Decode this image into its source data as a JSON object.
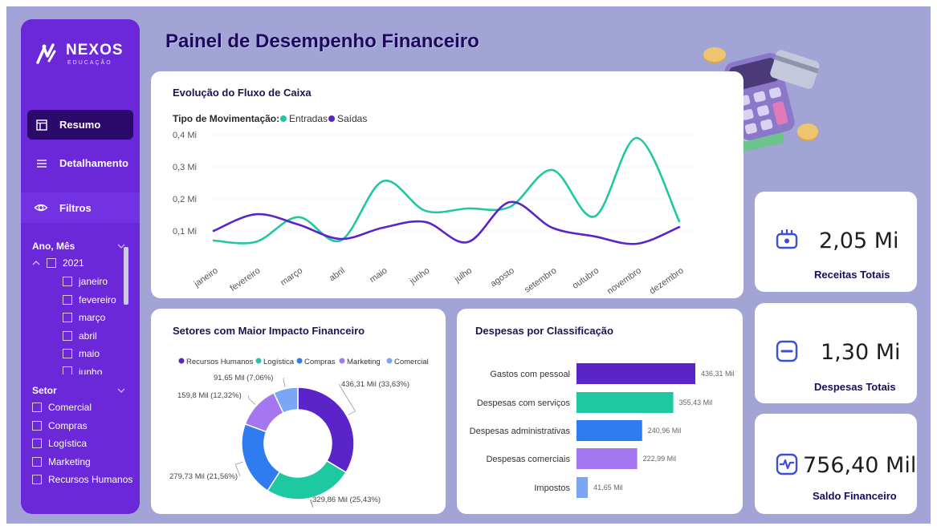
{
  "logo": {
    "name": "NEXOS",
    "sub": "EDUCAÇÃO"
  },
  "page_title": "Painel de Desempenho Financeiro",
  "nav": {
    "resumo": "Resumo",
    "detalhamento": "Detalhamento",
    "filtros": "Filtros"
  },
  "slicer_date": {
    "title": "Ano, Mês",
    "year": "2021",
    "months": [
      "janeiro",
      "fevereiro",
      "março",
      "abril",
      "maio",
      "junho"
    ]
  },
  "slicer_sector": {
    "title": "Setor",
    "items": [
      "Comercial",
      "Compras",
      "Logística",
      "Marketing",
      "Recursos Humanos"
    ]
  },
  "line_card": {
    "title": "Evolução do Fluxo de Caixa",
    "legend_prefix": "Tipo de Movimentação:"
  },
  "donut_card": {
    "title": "Setores com Maior Impacto Financeiro"
  },
  "bar_card": {
    "title": "Despesas por Classificação"
  },
  "kpis": {
    "receitas": {
      "value": "2,05 Mi",
      "label": "Receitas Totais",
      "icon": "wallet-icon"
    },
    "despesas": {
      "value": "1,30 Mi",
      "label": "Despesas Totais",
      "icon": "minus-icon"
    },
    "saldo": {
      "value": "756,40 Mil",
      "label": "Saldo Financeiro",
      "icon": "pulse-icon"
    }
  },
  "colors": {
    "teal": "#1ec8a0",
    "purple": "#5a24c9",
    "blue": "#2f7bf0",
    "lilac": "#a477f0",
    "light_blue": "#7aa6f5",
    "sidebar": "#6a28d9",
    "background": "#a3a4d6"
  },
  "chart_data": [
    {
      "type": "line",
      "title": "Evolução do Fluxo de Caixa",
      "x": [
        "janeiro",
        "fevereiro",
        "março",
        "abril",
        "maio",
        "junho",
        "julho",
        "agosto",
        "setembro",
        "outubro",
        "novembro",
        "dezembro"
      ],
      "y_ticks": [
        "0,1 Mi",
        "0,2 Mi",
        "0,3 Mi",
        "0,4 Mi"
      ],
      "ylim": [
        0,
        0.4
      ],
      "series": [
        {
          "name": "Entradas",
          "color": "#1ec8a0",
          "values": [
            0.07,
            0.066,
            0.143,
            0.07,
            0.255,
            0.163,
            0.17,
            0.175,
            0.29,
            0.145,
            0.39,
            0.13
          ]
        },
        {
          "name": "Saídas",
          "color": "#5a24c9",
          "values": [
            0.1,
            0.152,
            0.12,
            0.075,
            0.11,
            0.128,
            0.065,
            0.19,
            0.11,
            0.083,
            0.06,
            0.112
          ]
        }
      ],
      "grid": true,
      "legend": "top-left"
    },
    {
      "type": "pie",
      "title": "Setores com Maior Impacto Financeiro",
      "slices": [
        {
          "name": "Recursos Humanos",
          "value": 436.31,
          "label": "436,31 Mil (33,63%)",
          "color": "#5a24c9"
        },
        {
          "name": "Logística",
          "value": 329.86,
          "label": "329,86 Mil (25,43%)",
          "color": "#1ec8a0"
        },
        {
          "name": "Compras",
          "value": 279.73,
          "label": "279,73 Mil (21,56%)",
          "color": "#2f7bf0"
        },
        {
          "name": "Marketing",
          "value": 159.8,
          "label": "159,8 Mil (12,32%)",
          "color": "#a477f0"
        },
        {
          "name": "Comercial",
          "value": 91.65,
          "label": "91,65 Mil (7,06%)",
          "color": "#7aa6f5"
        }
      ],
      "legend": "top"
    },
    {
      "type": "bar",
      "title": "Despesas por Classificação",
      "categories": [
        "Gastos com pessoal",
        "Despesas com serviços",
        "Despesas administrativas",
        "Despesas comerciais",
        "Impostos"
      ],
      "values": [
        436.31,
        355.43,
        240.96,
        222.99,
        41.65
      ],
      "labels": [
        "436,31 Mil",
        "355,43 Mil",
        "240,96 Mil",
        "222,99 Mil",
        "41,65 Mil"
      ],
      "colors": [
        "#5a24c9",
        "#1ec8a0",
        "#2f7bf0",
        "#a477f0",
        "#7aa6f5"
      ],
      "orientation": "horizontal"
    }
  ]
}
